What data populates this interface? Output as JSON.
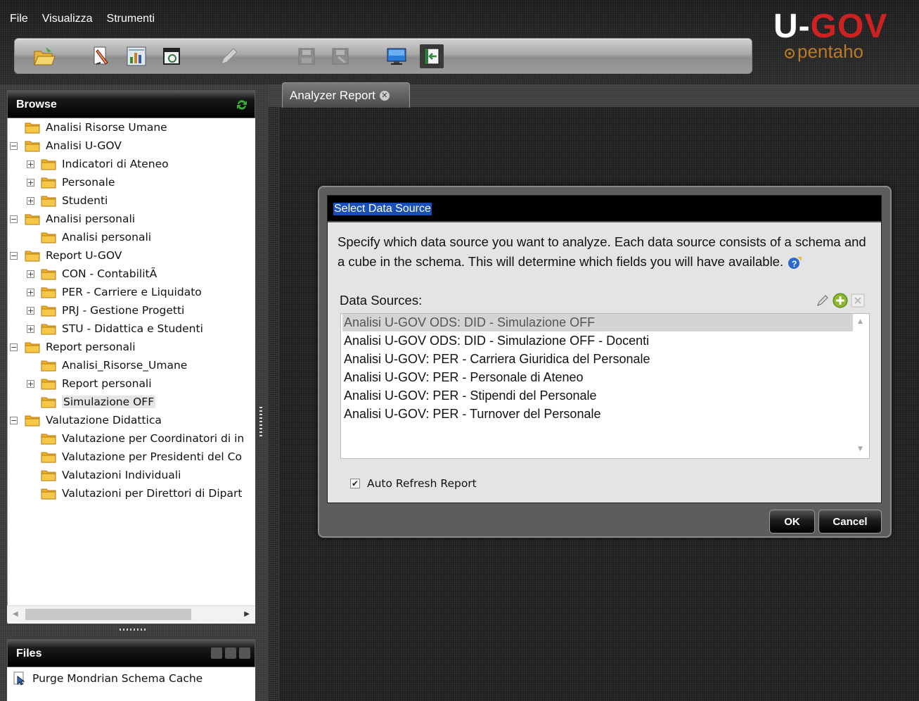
{
  "menu": {
    "file": "File",
    "view": "Visualizza",
    "tools": "Strumenti"
  },
  "logo": {
    "main_u": "U",
    "main_dash": "-",
    "main_gov": "GOV",
    "sub": "pentaho"
  },
  "toolbar_icons": [
    "open-folder-icon",
    "edit-report-icon",
    "chart-report-icon",
    "scheduler-icon",
    "pencil-icon",
    "save-icon",
    "save-as-icon",
    "monitor-icon",
    "workspace-icon"
  ],
  "browse": {
    "title": "Browse",
    "tree": [
      {
        "label": "Analisi Risorse Umane",
        "level": 0,
        "expander": ""
      },
      {
        "label": "Analisi U-GOV",
        "level": 0,
        "expander": "-"
      },
      {
        "label": "Indicatori di Ateneo",
        "level": 1,
        "expander": "+"
      },
      {
        "label": "Personale",
        "level": 1,
        "expander": "+"
      },
      {
        "label": "Studenti",
        "level": 1,
        "expander": "+"
      },
      {
        "label": "Analisi personali",
        "level": 0,
        "expander": "-"
      },
      {
        "label": "Analisi personali",
        "level": 1,
        "expander": ""
      },
      {
        "label": "Report U-GOV",
        "level": 0,
        "expander": "-"
      },
      {
        "label": "CON - ContabilitÃ",
        "level": 1,
        "expander": "+"
      },
      {
        "label": "PER - Carriere e Liquidato",
        "level": 1,
        "expander": "+"
      },
      {
        "label": "PRJ - Gestione Progetti",
        "level": 1,
        "expander": "+"
      },
      {
        "label": "STU - Didattica e Studenti",
        "level": 1,
        "expander": "+"
      },
      {
        "label": "Report personali",
        "level": 0,
        "expander": "-"
      },
      {
        "label": "Analisi_Risorse_Umane",
        "level": 1,
        "expander": ""
      },
      {
        "label": "Report personali",
        "level": 1,
        "expander": "+"
      },
      {
        "label": "Simulazione OFF",
        "level": 1,
        "expander": "",
        "selected": true
      },
      {
        "label": "Valutazione Didattica",
        "level": 0,
        "expander": "-"
      },
      {
        "label": "Valutazione per Coordinatori di in",
        "level": 1,
        "expander": ""
      },
      {
        "label": "Valutazione per Presidenti del Co",
        "level": 1,
        "expander": ""
      },
      {
        "label": "Valutazioni Individuali",
        "level": 1,
        "expander": ""
      },
      {
        "label": "Valutazioni per Direttori di Dipart",
        "level": 1,
        "expander": ""
      }
    ]
  },
  "files": {
    "title": "Files",
    "items": [
      "Purge Mondrian Schema Cache"
    ]
  },
  "tab": {
    "label": "Analyzer Report"
  },
  "dialog": {
    "title": "Select Data Source",
    "description": "Specify which data source you want to analyze. Each data source consists of a schema and a cube in the schema. This will determine which fields you will have available.",
    "sources_label": "Data Sources:",
    "sources": [
      "Analisi U-GOV ODS: DID - Simulazione OFF",
      "Analisi U-GOV ODS: DID - Simulazione OFF - Docenti",
      "Analisi U-GOV: PER - Carriera Giuridica del Personale",
      "Analisi U-GOV: PER - Personale di Ateneo",
      "Analisi U-GOV: PER - Stipendi del Personale",
      "Analisi U-GOV: PER - Turnover del Personale"
    ],
    "selected_index": 0,
    "auto_refresh_label": "Auto Refresh Report",
    "auto_refresh_checked": true,
    "ok_label": "OK",
    "cancel_label": "Cancel"
  }
}
